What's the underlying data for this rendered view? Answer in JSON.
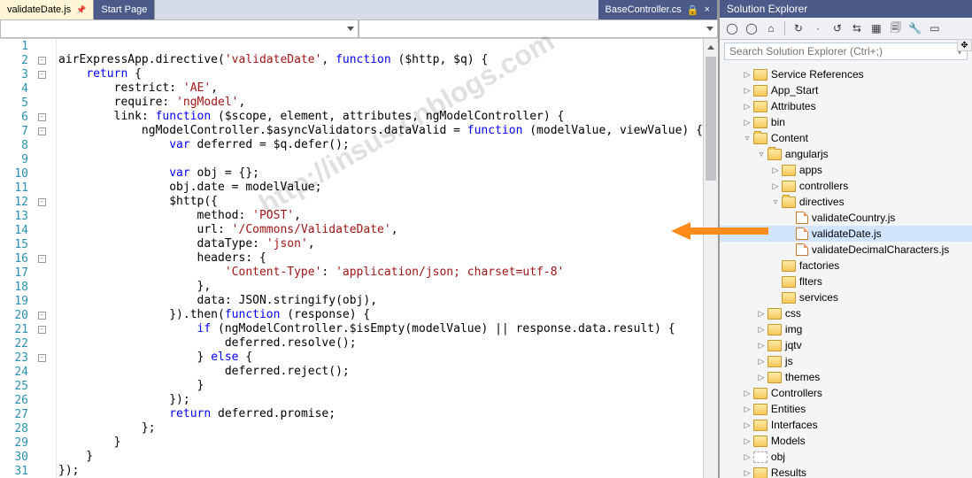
{
  "tabs": {
    "active": "validateDate.js",
    "start": "Start Page",
    "far": "BaseController.cs"
  },
  "search": {
    "placeholder": "Search Solution Explorer (Ctrl+;)"
  },
  "solution": {
    "title": "Solution Explorer"
  },
  "tree": {
    "n0": "Service References",
    "n1": "App_Start",
    "n2": "Attributes",
    "n3": "bin",
    "n4": "Content",
    "n5": "angularjs",
    "n6": "apps",
    "n7": "controllers",
    "n8": "directives",
    "n9": "validateCountry.js",
    "n10": "validateDate.js",
    "n11": "validateDecimalCharacters.js",
    "n12": "factories",
    "n13": "flters",
    "n14": "services",
    "n15": "css",
    "n16": "img",
    "n17": "jqtv",
    "n18": "js",
    "n19": "themes",
    "n20": "Controllers",
    "n21": "Entities",
    "n22": "Interfaces",
    "n23": "Models",
    "n24": "obj",
    "n25": "Results"
  },
  "code": {
    "l1": "",
    "l2": "airExpressApp.directive('validateDate', function ($http, $q) {",
    "l3": "    return {",
    "l4": "        restrict: 'AE',",
    "l5": "        require: 'ngModel',",
    "l6": "        link: function ($scope, element, attributes, ngModelController) {",
    "l7": "            ngModelController.$asyncValidators.dataValid = function (modelValue, viewValue) {",
    "l8": "                var deferred = $q.defer();",
    "l9": "",
    "l10": "                var obj = {};",
    "l11": "                obj.date = modelValue;",
    "l12": "                $http({",
    "l13": "                    method: 'POST',",
    "l14": "                    url: '/Commons/ValidateDate',",
    "l15": "                    dataType: 'json',",
    "l16": "                    headers: {",
    "l17": "                        'Content-Type': 'application/json; charset=utf-8'",
    "l18": "                    },",
    "l19": "                    data: JSON.stringify(obj),",
    "l20": "                }).then(function (response) {",
    "l21": "                    if (ngModelController.$isEmpty(modelValue) || response.data.result) {",
    "l22": "                        deferred.resolve();",
    "l23": "                    } else {",
    "l24": "                        deferred.reject();",
    "l25": "                    }",
    "l26": "                });",
    "l27": "                return deferred.promise;",
    "l28": "            };",
    "l29": "        }",
    "l30": "    }",
    "l31": "});"
  },
  "watermark": "http://insus.cnblogs.com"
}
